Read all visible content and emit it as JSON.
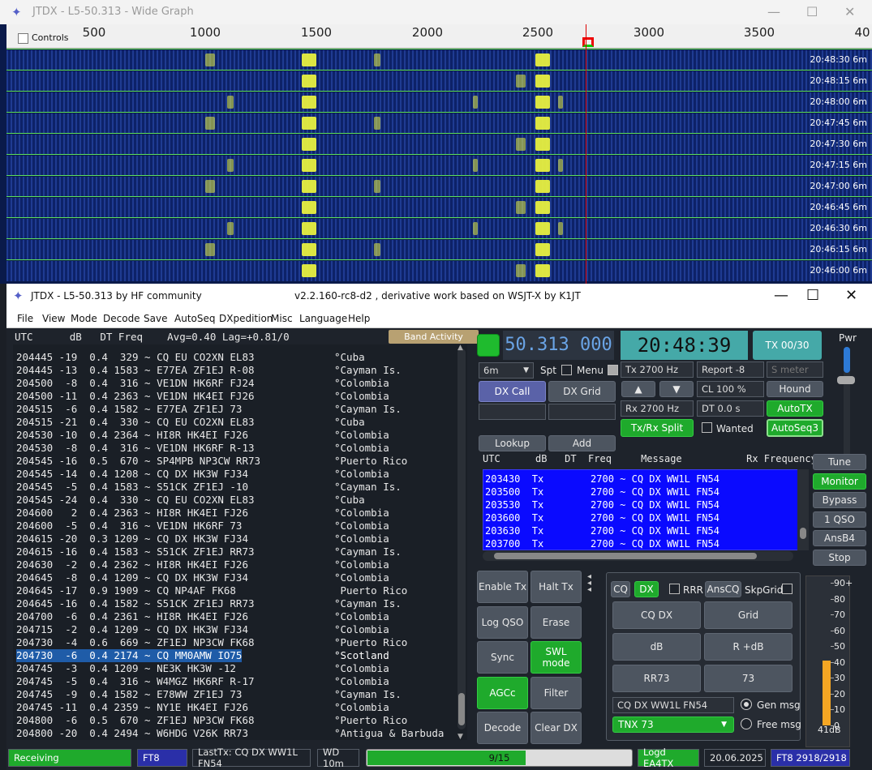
{
  "wide_graph": {
    "title": "JTDX - L5-50.313 - Wide Graph",
    "controls_label": "Controls",
    "scale_ticks": [
      "500",
      "1000",
      "1500",
      "2000",
      "2500",
      "3000",
      "3500",
      "40"
    ],
    "timestamps": [
      "20:48:30",
      "20:48:15",
      "20:48:00",
      "20:47:45",
      "20:47:30",
      "20:47:15",
      "20:47:00",
      "20:46:45",
      "20:46:30",
      "20:46:15",
      "20:46:00"
    ],
    "band_label": "6m"
  },
  "main": {
    "title": "JTDX - L5-50.313  by HF community",
    "title_center": "v2.2.160-rc8-d2 , derivative work based on WSJT-X by K1JT",
    "menu": [
      "File",
      "View",
      "Mode",
      "Decode",
      "Save",
      "AutoSeq",
      "DXpedition",
      "Misc",
      "Language",
      "Help"
    ],
    "decode_header": "UTC      dB   DT Freq    Avg=0.40 Lag=+0.81/0",
    "band_activity_label": "Band Activity",
    "decodes": [
      {
        "utc": "204445",
        "db": "-19",
        "dt": "0.4",
        "freq": "329",
        "msg": "CQ EU CO2XN EL83",
        "country": "°Cuba"
      },
      {
        "utc": "204445",
        "db": "-13",
        "dt": "0.4",
        "freq": "1583",
        "msg": "E77EA ZF1EJ R-08",
        "country": "°Cayman Is."
      },
      {
        "utc": "204500",
        "db": "-8",
        "dt": "0.4",
        "freq": "316",
        "msg": "VE1DN HK6RF FJ24",
        "country": "°Colombia"
      },
      {
        "utc": "204500",
        "db": "-11",
        "dt": "0.4",
        "freq": "2363",
        "msg": "VE1DN HK4EI FJ26",
        "country": "°Colombia"
      },
      {
        "utc": "204515",
        "db": "-6",
        "dt": "0.4",
        "freq": "1582",
        "msg": "E77EA ZF1EJ 73",
        "country": "°Cayman Is."
      },
      {
        "utc": "204515",
        "db": "-21",
        "dt": "0.4",
        "freq": "330",
        "msg": "CQ EU CO2XN EL83",
        "country": "°Cuba"
      },
      {
        "utc": "204530",
        "db": "-10",
        "dt": "0.4",
        "freq": "2364",
        "msg": "HI8R HK4EI FJ26",
        "country": "°Colombia"
      },
      {
        "utc": "204530",
        "db": "-8",
        "dt": "0.4",
        "freq": "316",
        "msg": "VE1DN HK6RF R-13",
        "country": "°Colombia"
      },
      {
        "utc": "204545",
        "db": "-16",
        "dt": "0.5",
        "freq": "670",
        "msg": "SP4MPB NP3CW RR73",
        "country": "°Puerto Rico"
      },
      {
        "utc": "204545",
        "db": "-14",
        "dt": "0.4",
        "freq": "1208",
        "msg": "CQ DX HK3W FJ34",
        "country": "°Colombia"
      },
      {
        "utc": "204545",
        "db": "-5",
        "dt": "0.4",
        "freq": "1583",
        "msg": "S51CK ZF1EJ -10",
        "country": "°Cayman Is."
      },
      {
        "utc": "204545",
        "db": "-24",
        "dt": "0.4",
        "freq": "330",
        "msg": "CQ EU CO2XN EL83",
        "country": "°Cuba"
      },
      {
        "utc": "204600",
        "db": "2",
        "dt": "0.4",
        "freq": "2363",
        "msg": "HI8R HK4EI FJ26",
        "country": "°Colombia"
      },
      {
        "utc": "204600",
        "db": "-5",
        "dt": "0.4",
        "freq": "316",
        "msg": "VE1DN HK6RF 73",
        "country": "°Colombia"
      },
      {
        "utc": "204615",
        "db": "-20",
        "dt": "0.3",
        "freq": "1209",
        "msg": "CQ DX HK3W FJ34",
        "country": "°Colombia"
      },
      {
        "utc": "204615",
        "db": "-16",
        "dt": "0.4",
        "freq": "1583",
        "msg": "S51CK ZF1EJ RR73",
        "country": "°Cayman Is."
      },
      {
        "utc": "204630",
        "db": "-2",
        "dt": "0.4",
        "freq": "2362",
        "msg": "HI8R HK4EI FJ26",
        "country": "°Colombia"
      },
      {
        "utc": "204645",
        "db": "-8",
        "dt": "0.4",
        "freq": "1209",
        "msg": "CQ DX HK3W FJ34",
        "country": "°Colombia"
      },
      {
        "utc": "204645",
        "db": "-17",
        "dt": "0.9",
        "freq": "1909",
        "msg": "CQ NP4AF FK68",
        "country": " Puerto Rico"
      },
      {
        "utc": "204645",
        "db": "-16",
        "dt": "0.4",
        "freq": "1582",
        "msg": "S51CK ZF1EJ RR73",
        "country": "°Cayman Is."
      },
      {
        "utc": "204700",
        "db": "-6",
        "dt": "0.4",
        "freq": "2361",
        "msg": "HI8R HK4EI FJ26",
        "country": "°Colombia"
      },
      {
        "utc": "204715",
        "db": "-2",
        "dt": "0.4",
        "freq": "1209",
        "msg": "CQ DX HK3W FJ34",
        "country": "°Colombia"
      },
      {
        "utc": "204730",
        "db": "-4",
        "dt": "0.6",
        "freq": "669",
        "msg": "ZF1EJ NP3CW FK68",
        "country": "°Puerto Rico"
      },
      {
        "utc": "204730",
        "db": "-6",
        "dt": "0.4",
        "freq": "2174",
        "msg": "CQ MM0AMW IO75",
        "country": "°Scotland"
      },
      {
        "utc": "204745",
        "db": "-3",
        "dt": "0.4",
        "freq": "1209",
        "msg": "NE3K HK3W -12",
        "country": "°Colombia"
      },
      {
        "utc": "204745",
        "db": "-5",
        "dt": "0.4",
        "freq": "316",
        "msg": "W4MGZ HK6RF R-17",
        "country": "°Colombia"
      },
      {
        "utc": "204745",
        "db": "-9",
        "dt": "0.4",
        "freq": "1582",
        "msg": "E78WW ZF1EJ 73",
        "country": "°Cayman Is."
      },
      {
        "utc": "204745",
        "db": "-11",
        "dt": "0.4",
        "freq": "2359",
        "msg": "NY1E HK4EI FJ26",
        "country": "°Colombia"
      },
      {
        "utc": "204800",
        "db": "-6",
        "dt": "0.5",
        "freq": "670",
        "msg": "ZF1EJ NP3CW FK68",
        "country": "°Puerto Rico"
      },
      {
        "utc": "204800",
        "db": "-20",
        "dt": "0.4",
        "freq": "2494",
        "msg": "W6HDG V26K RR73",
        "country": "°Antigua & Barbuda"
      }
    ],
    "selected_decode_index": 23,
    "dial_frequency": "50.313 000",
    "clock": "20:48:39",
    "tx_counter": "TX 00/30",
    "pwr_label": "Pwr",
    "band_select": "6m",
    "spt_label": "Spt",
    "menu_label": "Menu",
    "tx_freq": "Tx  2700  Hz",
    "rx_freq": "Rx  2700  Hz",
    "report": "Report -8",
    "s_meter_placeholder": "S meter",
    "cl": "CL  100 %",
    "dt": "DT 0.0 s",
    "hound_label": "Hound",
    "autotx_label": "AutoTX",
    "autoseq_label": "AutoSeq3",
    "dx_call_label": "DX Call",
    "dx_grid_label": "DX Grid",
    "txrx_split_label": "Tx/Rx Split",
    "wanted_label": "Wanted",
    "lookup_label": "Lookup",
    "add_label": "Add",
    "rx_header": "UTC      dB   DT  Freq     Message           Rx Frequency",
    "rx_rows": [
      "203430  Tx        2700 ~ CQ DX WW1L FN54",
      "203500  Tx        2700 ~ CQ DX WW1L FN54",
      "203530  Tx        2700 ~ CQ DX WW1L FN54",
      "203600  Tx        2700 ~ CQ DX WW1L FN54",
      "203630  Tx        2700 ~ CQ DX WW1L FN54",
      "203700  Tx        2700 ~ CQ DX WW1L FN54"
    ],
    "side_buttons": [
      "Tune",
      "Monitor",
      "Bypass",
      "1 QSO",
      "AnsB4",
      "Stop"
    ],
    "left_buttons": [
      "Enable Tx",
      "Halt Tx",
      "Log QSO",
      "Erase",
      "Sync",
      "SWL mode",
      "AGCc",
      "Filter",
      "Decode",
      "Clear DX"
    ],
    "macro_top": {
      "cq": "CQ",
      "dx": "DX",
      "rrr": "RRR",
      "anscq": "AnsCQ",
      "skpgrid": "SkpGrid"
    },
    "macro_buttons": [
      "CQ DX",
      "Grid",
      "dB",
      "R +dB",
      "RR73",
      "73"
    ],
    "message_field": "CQ DX WW1L FN54",
    "tnx_select": "TNX 73",
    "gen_msg_label": "Gen msg",
    "free_msg_label": "Free msg",
    "meter_scale": [
      "90+",
      "80",
      "70",
      "60",
      "50",
      "40",
      "30",
      "20",
      "10",
      "0"
    ],
    "meter_value_db": 41,
    "meter_reading": "41dB",
    "status": {
      "receiving": "Receiving",
      "mode": "FT8",
      "last_tx": "LastTx: CQ DX WW1L FN54",
      "wd": "WD 10m",
      "progress_text": "9/15",
      "progress_value": 9,
      "progress_max": 15,
      "logd": "Logd EA4TX",
      "date": "20.06.2025",
      "ft8_count": "FT8  2918/2918"
    }
  }
}
